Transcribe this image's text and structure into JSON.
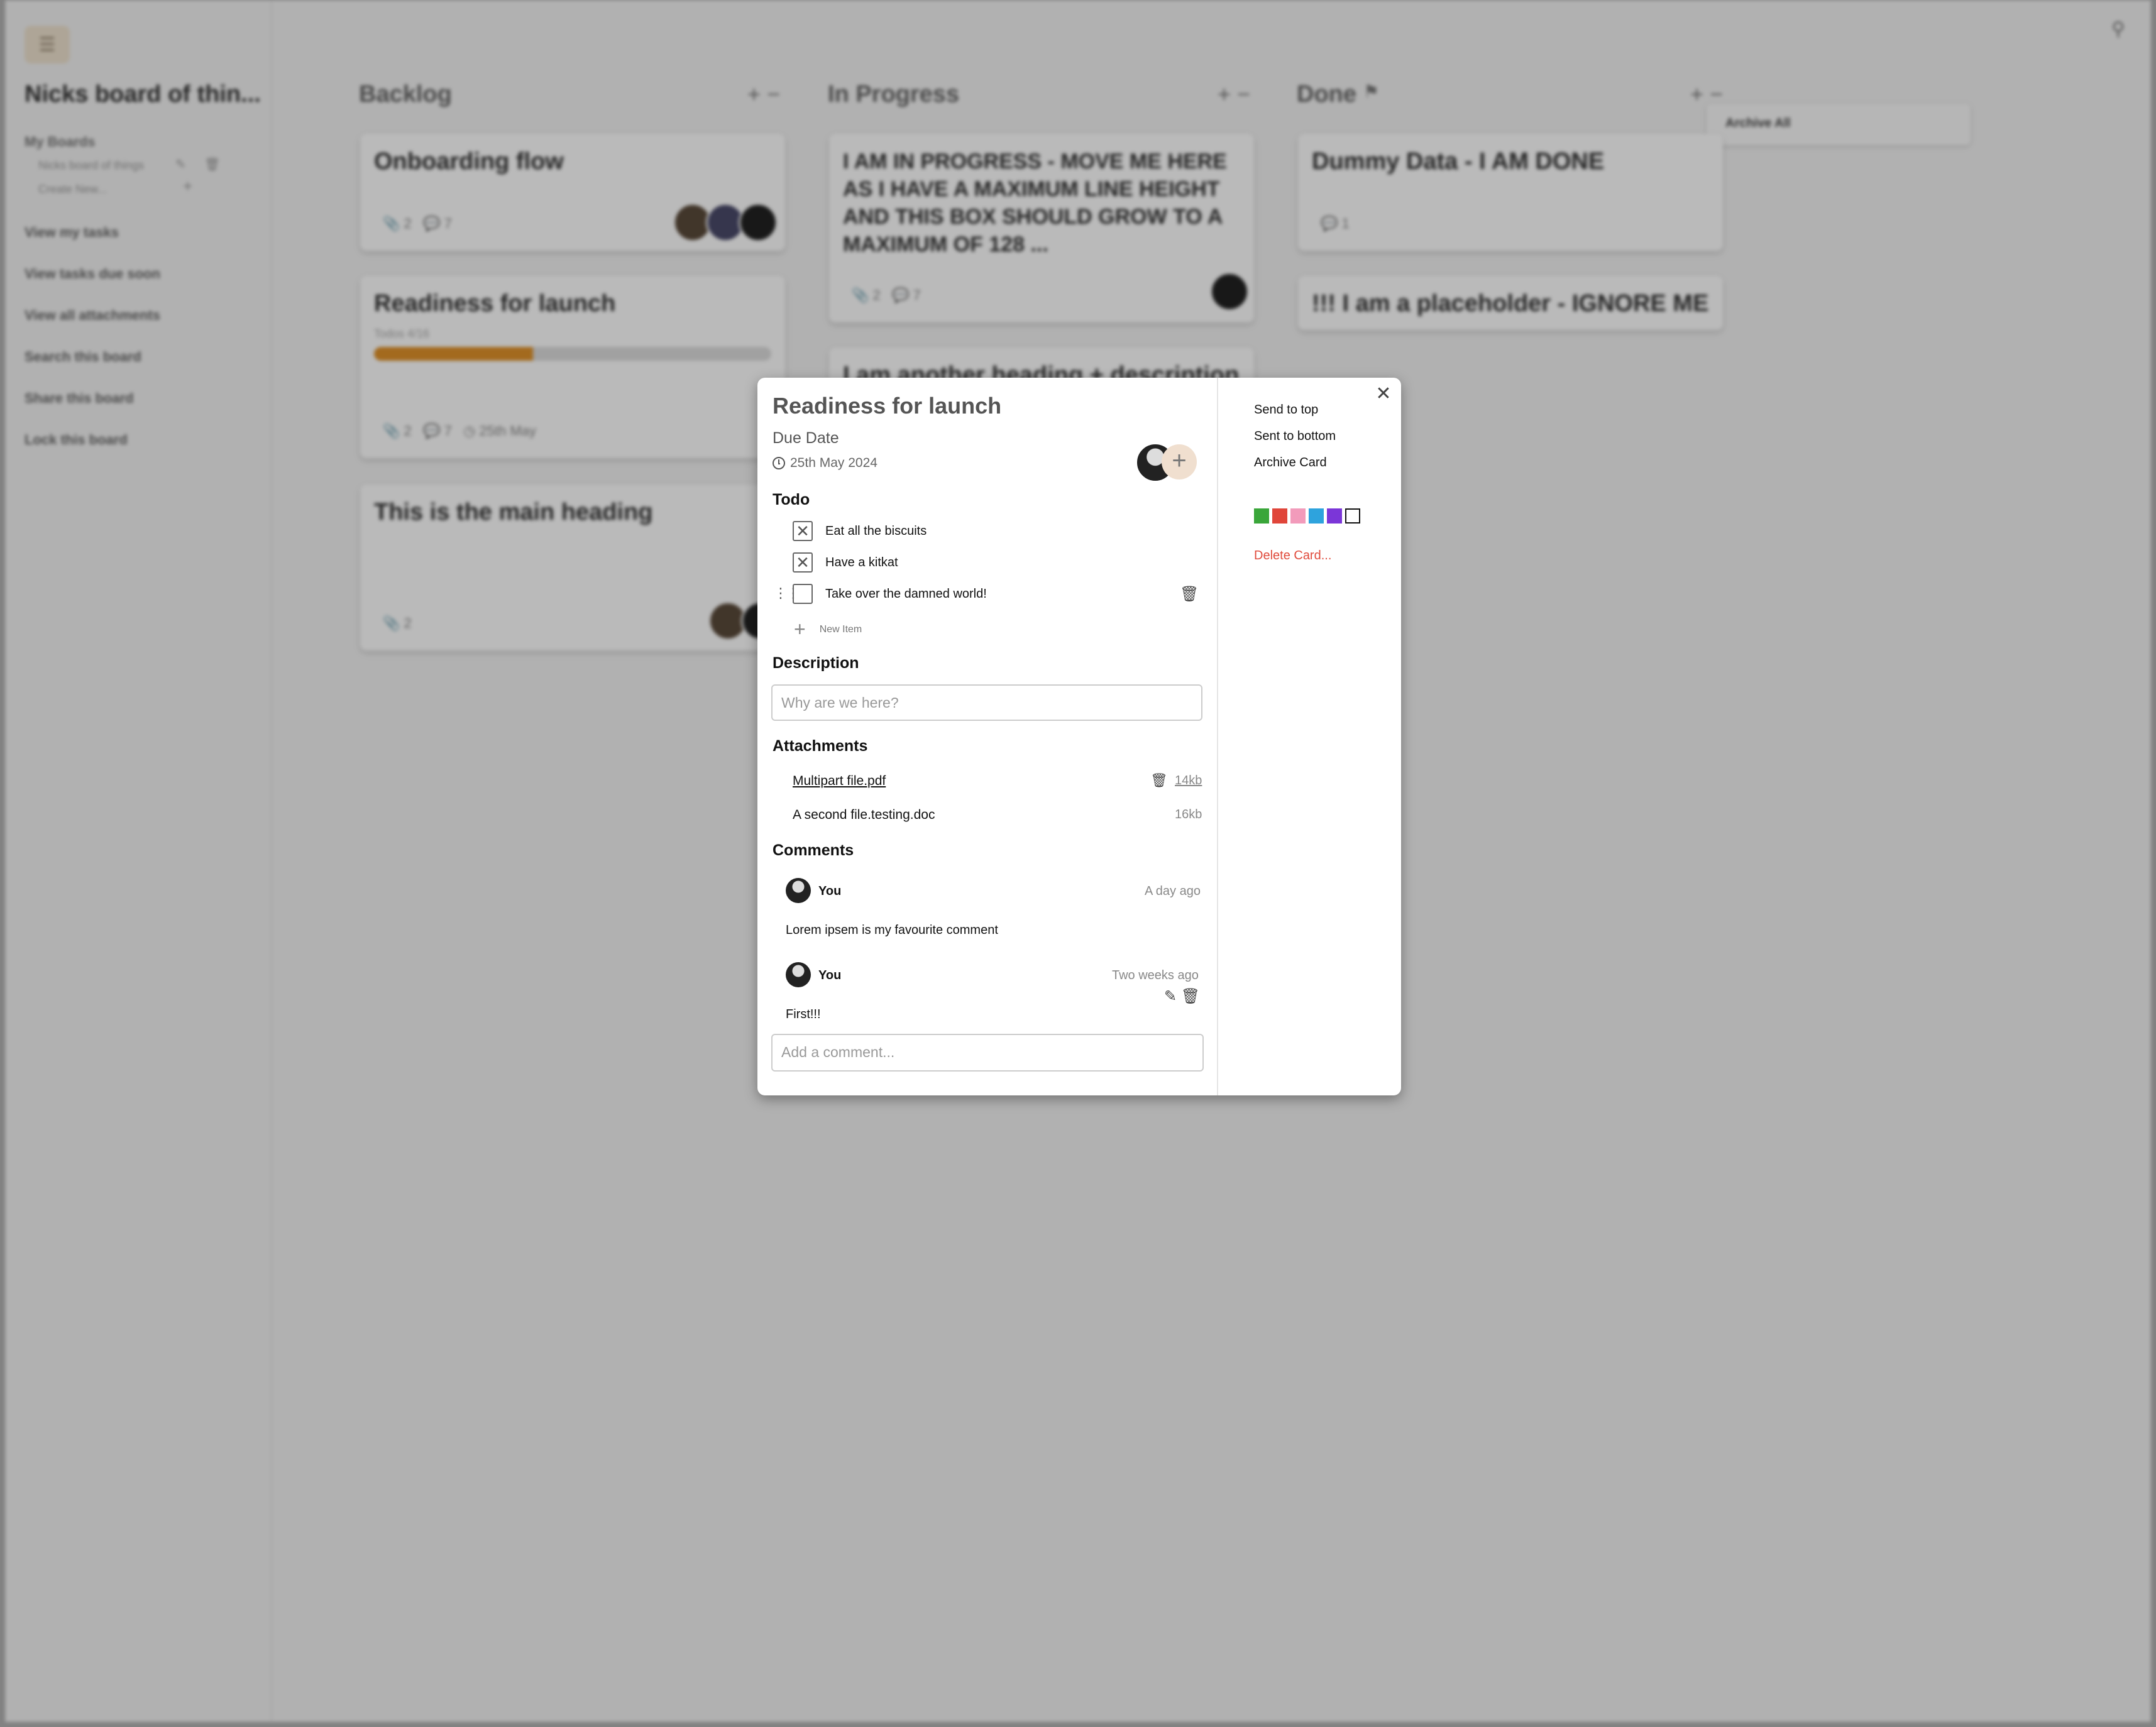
{
  "sidebar": {
    "board_title": "Nicks board of thin...",
    "my_boards_label": "My Boards",
    "board_item": "Nicks board of things",
    "create_new": "Create New...",
    "links": [
      "View my tasks",
      "View tasks due soon",
      "View all attachments",
      "Search this board",
      "Share this board",
      "Lock this board"
    ]
  },
  "columns": {
    "backlog": {
      "title": "Backlog",
      "cards": [
        {
          "title": "Onboarding flow",
          "attachments": "2",
          "comments": "7"
        },
        {
          "title": "Readiness for launch",
          "todos": "Todos 4/16",
          "progress": 0.4,
          "attachments": "2",
          "comments": "7",
          "due": "25th May"
        },
        {
          "title": "This is the main heading",
          "attachments": "2"
        }
      ]
    },
    "in_progress": {
      "title": "In Progress",
      "cards": [
        {
          "title": "I AM IN PROGRESS - MOVE ME HERE AS I HAVE A MAXIMUM LINE HEIGHT AND THIS BOX SHOULD GROW TO A MAXIMUM OF 128 ...",
          "attachments": "2",
          "comments": "7"
        },
        {
          "title": "I am another heading + description"
        }
      ]
    },
    "done": {
      "title": "Done",
      "cards": [
        {
          "title": "Dummy Data - I AM DONE",
          "comments": "1"
        },
        {
          "title": "!!! I am a placeholder - IGNORE ME"
        }
      ],
      "archive_all": "Archive All"
    }
  },
  "modal": {
    "title": "Readiness for launch",
    "due_label": "Due Date",
    "due_date": "25th May 2024",
    "todo_heading": "Todo",
    "todos": [
      {
        "text": "Eat all the biscuits",
        "done": true
      },
      {
        "text": "Have a kitkat",
        "done": true
      },
      {
        "text": "Take over the damned world!",
        "done": false
      }
    ],
    "new_item": "New Item",
    "description_heading": "Description",
    "description_placeholder": "Why are we here?",
    "attachments_heading": "Attachments",
    "attachments": [
      {
        "name": "Multipart file.pdf",
        "size": "14kb"
      },
      {
        "name": "A second file.testing.doc",
        "size": "16kb"
      }
    ],
    "comments_heading": "Comments",
    "comments": [
      {
        "author": "You",
        "time": "A day ago",
        "text": "Lorem ipsem is my favourite comment"
      },
      {
        "author": "You",
        "time": "Two weeks ago",
        "text": "First!!!"
      }
    ],
    "comment_placeholder": "Add a comment...",
    "actions": {
      "send_top": "Send to top",
      "send_bottom": "Sent to bottom",
      "archive": "Archive Card",
      "delete": "Delete Card..."
    },
    "swatch_colors": [
      "#3aa63a",
      "#e0453a",
      "#f29bbb",
      "#2ea3dd",
      "#7b36d8",
      "#ffffff"
    ]
  }
}
